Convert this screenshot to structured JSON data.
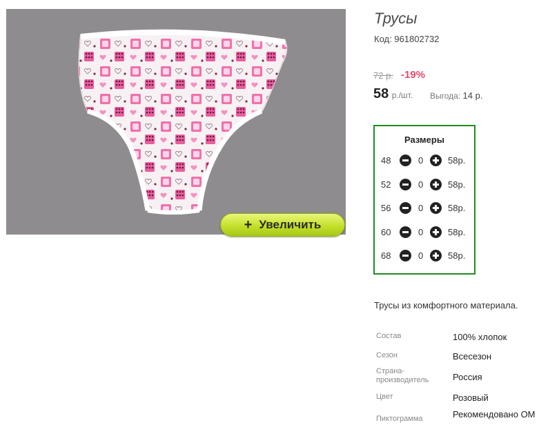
{
  "product": {
    "title": "Трусы",
    "code_label": "Код:",
    "code": "961802732"
  },
  "image": {
    "description_icon": "product-photo-panties",
    "zoom_label": "Увеличить",
    "zoom_icon": "plus-icon"
  },
  "pricing": {
    "old_price": "72 р.",
    "discount": "-19%",
    "price": "58",
    "unit": "р./шт.",
    "benefit_label": "Выгода:",
    "benefit_value": "14 р."
  },
  "sizes": {
    "title": "Размеры",
    "rows": [
      {
        "size": "48",
        "qty": "0",
        "price": "58р."
      },
      {
        "size": "52",
        "qty": "0",
        "price": "58р."
      },
      {
        "size": "56",
        "qty": "0",
        "price": "58р."
      },
      {
        "size": "60",
        "qty": "0",
        "price": "58р."
      },
      {
        "size": "68",
        "qty": "0",
        "price": "58р."
      }
    ]
  },
  "description": "Трусы из комфортного материала.",
  "attributes": [
    {
      "label": "Состав",
      "value": "100% хлопок"
    },
    {
      "label": "Сезон",
      "value": "Всесезон"
    },
    {
      "label": "Страна-\nпроизводитель",
      "value": "Россия"
    },
    {
      "label": "Цвет",
      "value": "Розовый"
    },
    {
      "label": "Пиктограмма",
      "value": "Рекомендовано ОМ"
    }
  ],
  "colors": {
    "discount": "#e24a6b",
    "sizes_border": "#1e8a1e",
    "zoom_button": "#c3e02a",
    "photo_bg": "#8f8c8f"
  }
}
